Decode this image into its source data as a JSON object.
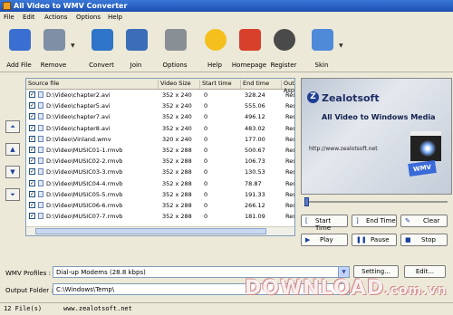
{
  "window": {
    "title": "All Video to WMV Converter"
  },
  "menu": [
    "File",
    "Edit",
    "Actions",
    "Options",
    "Help"
  ],
  "toolbar": [
    {
      "label": "Add File",
      "icon": "add-file-icon",
      "color": "#3a6fd1"
    },
    {
      "label": "Remove",
      "icon": "remove-icon",
      "color": "#7f8fa6"
    },
    {
      "label": "Convert",
      "icon": "convert-icon",
      "color": "#2e74c8"
    },
    {
      "label": "Join",
      "icon": "join-icon",
      "color": "#3b6db8"
    },
    {
      "label": "Options",
      "icon": "options-gears-icon",
      "color": "#8a8f96"
    },
    {
      "label": "Help",
      "icon": "help-star-icon",
      "color": "#f5c01d"
    },
    {
      "label": "Homepage",
      "icon": "homepage-house-icon",
      "color": "#d9402b"
    },
    {
      "label": "Register",
      "icon": "register-key-icon",
      "color": "#4a4a4a"
    },
    {
      "label": "Skin",
      "icon": "skin-icon",
      "color": "#4f8ad9"
    }
  ],
  "list": {
    "columns": [
      "Source file",
      "Video Size",
      "Start time",
      "End time",
      "Output Aspe"
    ],
    "rows": [
      {
        "file": "D:\\Video\\chapter2.avi",
        "size": "352 x 240",
        "start": "0",
        "end": "328.24",
        "output": "Resize pres"
      },
      {
        "file": "D:\\Video\\chapter5.avi",
        "size": "352 x 240",
        "start": "0",
        "end": "555.06",
        "output": "Resize pres"
      },
      {
        "file": "D:\\Video\\chapter7.avi",
        "size": "352 x 240",
        "start": "0",
        "end": "496.12",
        "output": "Resize pres"
      },
      {
        "file": "D:\\Video\\chapter8.avi",
        "size": "352 x 240",
        "start": "0",
        "end": "483.02",
        "output": "Resize pres"
      },
      {
        "file": "D:\\Video\\Vinland.wmv",
        "size": "320 x 240",
        "start": "0",
        "end": "177.00",
        "output": "Resize pres"
      },
      {
        "file": "D:\\Video\\MUSIC01-1.rmvb",
        "size": "352 x 288",
        "start": "0",
        "end": "500.67",
        "output": "Resize pres"
      },
      {
        "file": "D:\\Video\\MUSIC02-2.rmvb",
        "size": "352 x 288",
        "start": "0",
        "end": "106.73",
        "output": "Resize pres"
      },
      {
        "file": "D:\\Video\\MUSIC03-3.rmvb",
        "size": "352 x 288",
        "start": "0",
        "end": "130.53",
        "output": "Resize pres"
      },
      {
        "file": "D:\\Video\\MUSIC04-4.rmvb",
        "size": "352 x 288",
        "start": "0",
        "end": "78.87",
        "output": "Resize pres"
      },
      {
        "file": "D:\\Video\\MUSIC05-5.rmvb",
        "size": "352 x 288",
        "start": "0",
        "end": "191.33",
        "output": "Resize pres"
      },
      {
        "file": "D:\\Video\\MUSIC06-6.rmvb",
        "size": "352 x 288",
        "start": "0",
        "end": "266.12",
        "output": "Resize pres"
      },
      {
        "file": "D:\\Video\\MUSIC07-7.rmvb",
        "size": "352 x 288",
        "start": "0",
        "end": "181.09",
        "output": "Resize pres"
      }
    ]
  },
  "side_buttons": [
    "move-top-icon",
    "move-up-icon",
    "move-down-icon",
    "move-bottom-icon"
  ],
  "preview": {
    "logo_letter": "Z",
    "brand": "Zealotsoft",
    "product": "All Video to Windows Media",
    "url": "http://www.zealotsoft.net",
    "badge": "WMV"
  },
  "controls": {
    "start_time": "Start Time",
    "end_time": "End Time",
    "clear": "Clear",
    "play": "Play",
    "pause": "Pause",
    "stop": "Stop"
  },
  "profile": {
    "label": "WMV Profiles :",
    "value": "Dial-up Modems (28.8 kbps)",
    "setting_button": "Setting...",
    "edit_button": "Edit..."
  },
  "output": {
    "label": "Output Folder :",
    "value": "C:\\Windows\\Temp\\"
  },
  "status": {
    "files": "12 File(s)",
    "site": "www.zealotsoft.net"
  },
  "watermark": {
    "main": "DOWNLOAD",
    "suffix": ".com.vn"
  },
  "colors": {
    "titlebar": "#1c4fb0",
    "selection_accent": "#1a3f9c"
  }
}
